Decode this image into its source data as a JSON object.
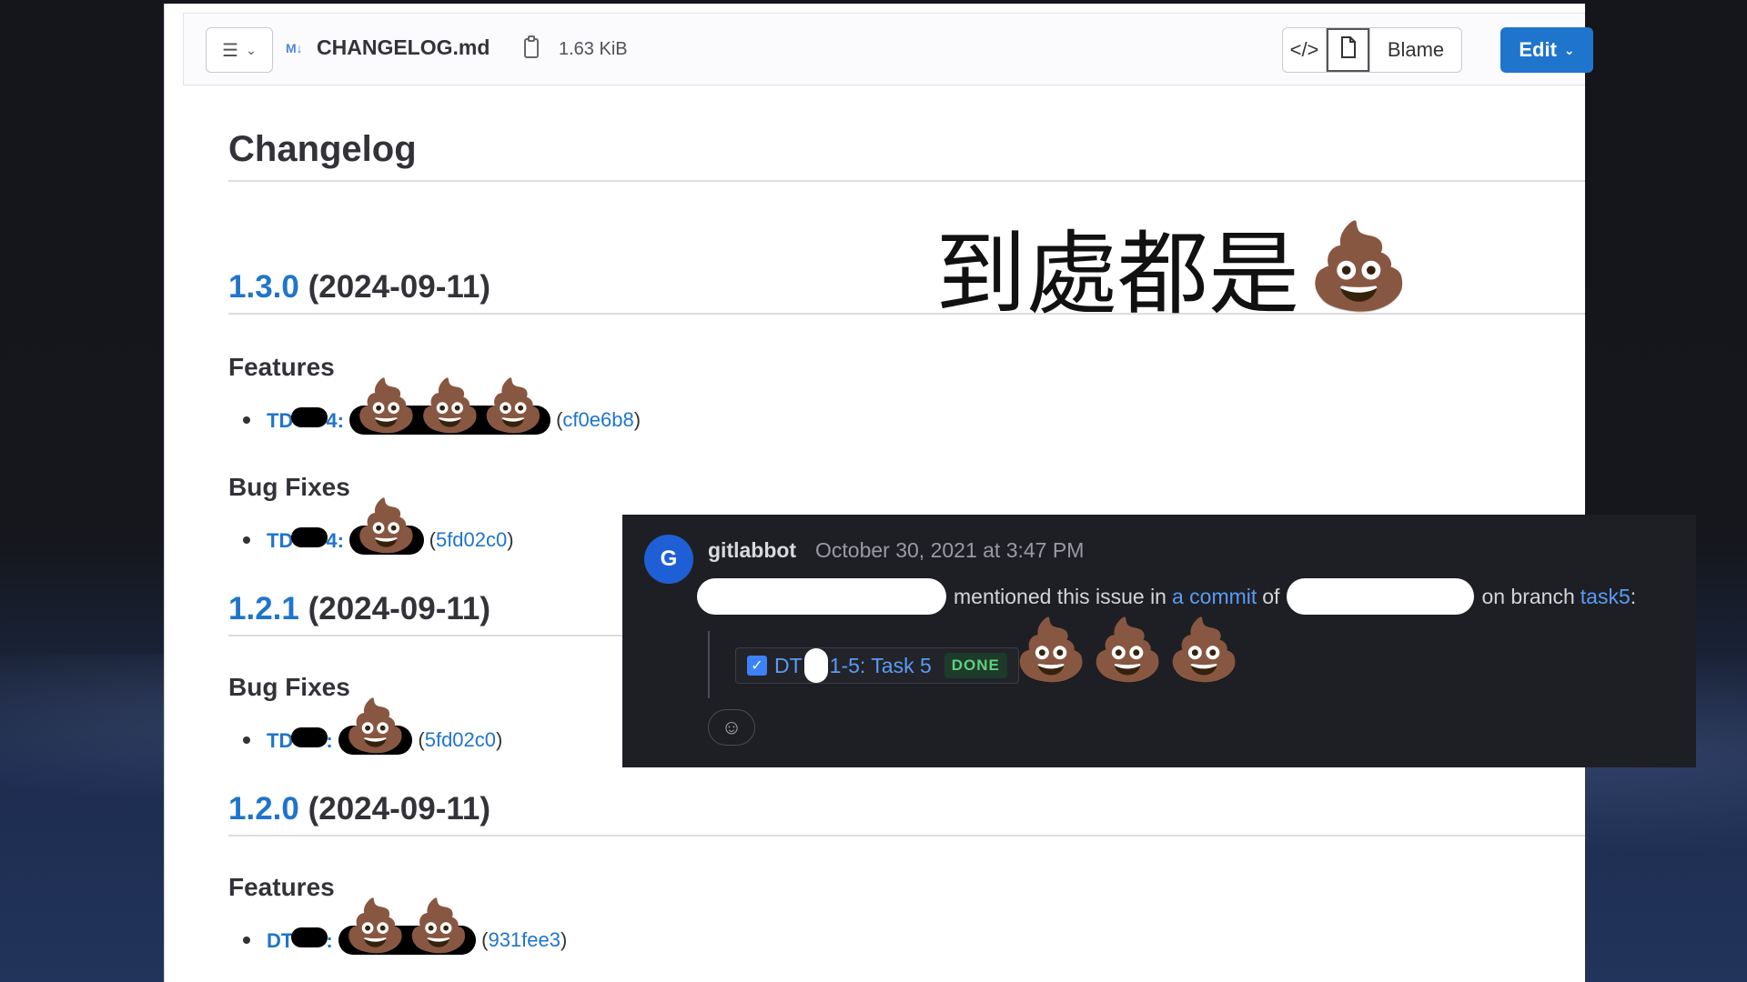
{
  "file_header": {
    "file_type_badge": "M↓",
    "file_name": "CHANGELOG.md",
    "file_size": "1.63 KiB",
    "blame_label": "Blame",
    "edit_label": "Edit"
  },
  "document": {
    "title": "Changelog",
    "caption": "到處都是",
    "versions": [
      {
        "version": "1.3.0",
        "date": "(2024-09-11)",
        "sections": [
          {
            "heading": "Features",
            "entry": {
              "key_prefix": "TD",
              "key_suffix": "4:",
              "sha": "cf0e6b8"
            }
          },
          {
            "heading": "Bug Fixes",
            "entry": {
              "key_prefix": "TD",
              "key_suffix": "4:",
              "sha": "5fd02c0"
            }
          }
        ]
      },
      {
        "version": "1.2.1",
        "date": "(2024-09-11)",
        "sections": [
          {
            "heading": "Bug Fixes",
            "entry": {
              "key_prefix": "TD",
              "key_suffix": ":",
              "sha": "5fd02c0"
            }
          }
        ]
      },
      {
        "version": "1.2.0",
        "date": "(2024-09-11)",
        "sections": [
          {
            "heading": "Features",
            "entry": {
              "key_prefix": "DT",
              "key_suffix": ":",
              "sha": "931fee3"
            }
          }
        ]
      }
    ]
  },
  "comment": {
    "avatar_letter": "G",
    "author": "gitlabbot",
    "timestamp": "October 30, 2021 at 3:47 PM",
    "mention_text": "mentioned this issue in",
    "commit_link": "a commit",
    "of_text": "of",
    "branch_text": "on branch",
    "branch_link": "task5",
    "colon": ":",
    "task_prefix": "DT",
    "task_suffix": "1-5: Task 5",
    "task_status": "DONE"
  },
  "colors": {
    "link": "#1f75cb",
    "edit_button": "#1f75cb",
    "overlay_bg": "#1e1f24",
    "overlay_link": "#5b9bf5",
    "done_green": "#5fcf7f"
  },
  "icons": [
    "list-icon",
    "chevron-down-icon",
    "markdown-icon",
    "copy-icon",
    "code-icon",
    "file-icon",
    "pile-of-poo-icon",
    "checkbox-checked-icon",
    "emoji-add-icon"
  ]
}
